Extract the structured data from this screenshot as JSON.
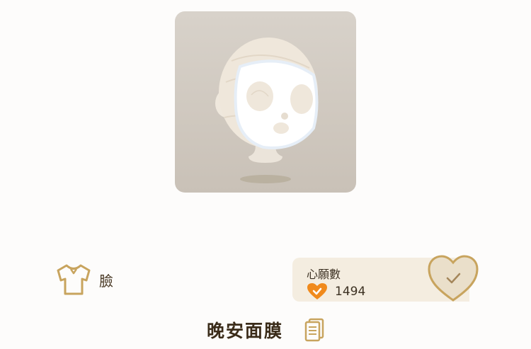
{
  "item": {
    "name": "晚安面膜",
    "category": "臉"
  },
  "wish": {
    "label": "心願數",
    "count": "1494",
    "heart_badge_color": "#f08a1c"
  },
  "colors": {
    "accent_gold": "#c8a45e",
    "text_dark": "#3b2c1a",
    "panel_bg": "#f4ede0"
  },
  "icons": {
    "category": "shirt-icon",
    "wish_button": "heart-check-icon",
    "details": "document-icon"
  }
}
